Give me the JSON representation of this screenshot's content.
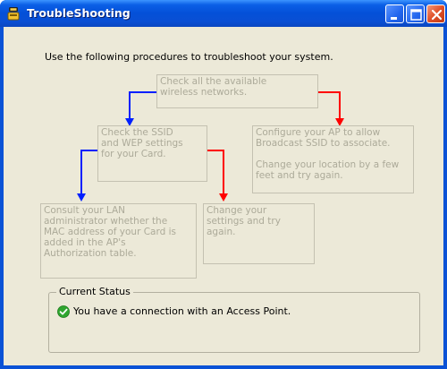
{
  "window": {
    "title": "TroubleShooting"
  },
  "intro": "Use the following procedures to troubleshoot your system.",
  "steps": {
    "check_networks": [
      "Check all the available",
      "wireless networks."
    ],
    "check_ssid": [
      "Check the SSID",
      "and WEP settings",
      "for your Card."
    ],
    "configure_ap": [
      "Configure your AP to allow",
      "Broadcast SSID to associate."
    ],
    "change_location": [
      "Change your location by a few",
      "feet and try again."
    ],
    "consult_admin": [
      "Consult your LAN",
      "administrator whether the",
      "MAC address of your Card is",
      "added in the AP's",
      "Authorization table."
    ],
    "change_settings": [
      "Change your",
      "settings and try",
      "again."
    ]
  },
  "status": {
    "legend": "Current Status",
    "message": "You have a connection with an Access Point.",
    "icon": "check-circle-icon"
  },
  "colors": {
    "arrow_blue": "#0020ff",
    "arrow_red": "#ff0000",
    "title_bar": "#0450d8",
    "client_bg": "#ece9d8"
  }
}
